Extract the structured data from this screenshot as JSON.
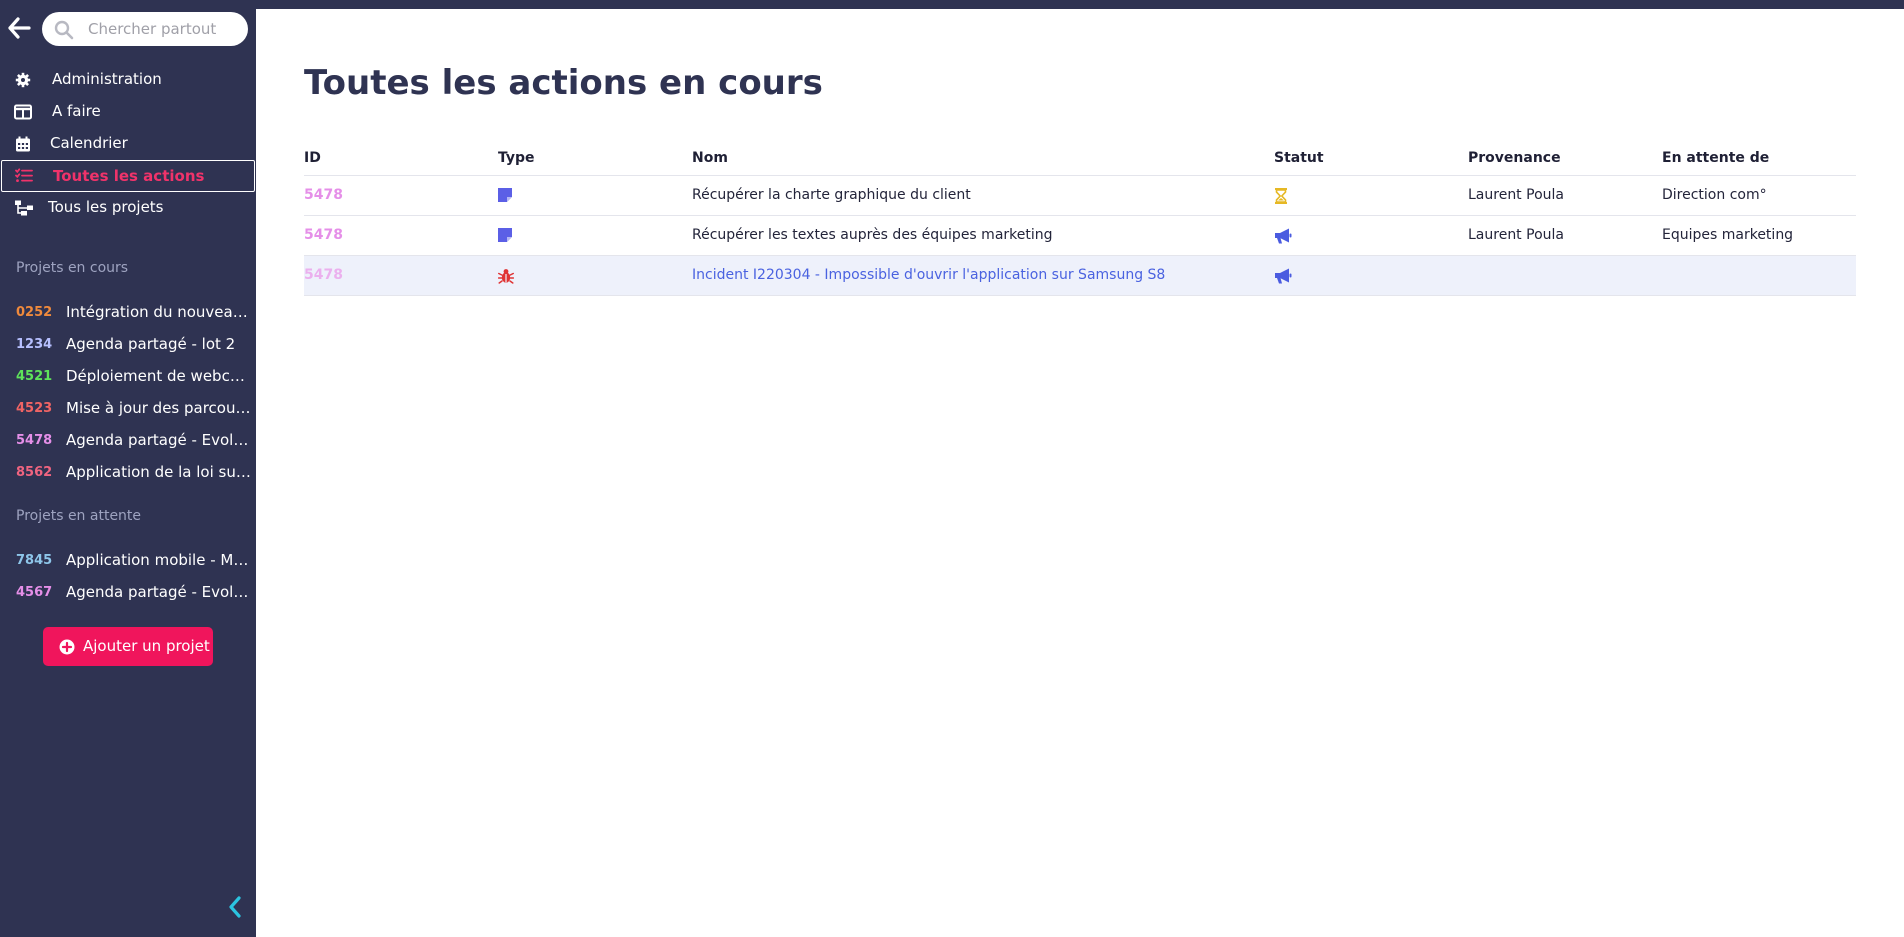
{
  "search": {
    "placeholder": "Chercher partout"
  },
  "nav": [
    {
      "label": "Administration",
      "icon": "gear-icon"
    },
    {
      "label": "A faire",
      "icon": "columns-icon"
    },
    {
      "label": "Calendrier",
      "icon": "calendar-icon"
    },
    {
      "label": "Toutes les actions",
      "icon": "list-check-icon",
      "active": true
    },
    {
      "label": "Tous les projets",
      "icon": "sitemap-icon"
    }
  ],
  "projects_in_progress": {
    "title": "Projets en cours",
    "items": [
      {
        "id": "0252",
        "name": "Intégration du nouveau p...",
        "color": "#f08a3c"
      },
      {
        "id": "1234",
        "name": "Agenda partagé - lot 2",
        "color": "#b7c0ff"
      },
      {
        "id": "4521",
        "name": "Déploiement de webcam ...",
        "color": "#5ee35a"
      },
      {
        "id": "4523",
        "name": "Mise à jour des parcours ...",
        "color": "#f06464"
      },
      {
        "id": "5478",
        "name": "Agenda partagé - Evoluti...",
        "color": "#e58fe8"
      },
      {
        "id": "8562",
        "name": "Application de la loi sur l...",
        "color": "#f06480"
      }
    ]
  },
  "projects_waiting": {
    "title": "Projets en attente",
    "items": [
      {
        "id": "7845",
        "name": "Application mobile - Mise...",
        "color": "#8ec6ea"
      },
      {
        "id": "4567",
        "name": "Agenda partagé - Evoluti...",
        "color": "#e58fe8"
      }
    ]
  },
  "add_project_label": "Ajouter un projet",
  "main": {
    "title": "Toutes les actions en cours",
    "columns": [
      "ID",
      "Type",
      "Nom",
      "Statut",
      "Provenance",
      "En attente de"
    ],
    "rows": [
      {
        "id": "5478",
        "type": "note-icon",
        "name": "Récupérer la charte graphique du client",
        "status": "hourglass-icon",
        "provenance": "Laurent Poula",
        "waiting": "Direction com°"
      },
      {
        "id": "5478",
        "type": "note-icon",
        "name": "Récupérer les textes auprès des équipes marketing",
        "status": "megaphone-icon",
        "provenance": "Laurent Poula",
        "waiting": "Equipes marketing"
      },
      {
        "id": "5478",
        "type": "bug-icon",
        "name": "Incident I220304 - Impossible d'ouvrir l'application sur Samsung S8",
        "status": "megaphone-icon",
        "provenance": "",
        "waiting": ""
      }
    ]
  },
  "colors": {
    "sidebar_bg": "#2f3352",
    "accent": "#f0155c",
    "active_label": "#f0336a",
    "link": "#4a62e0",
    "note_icon": "#5b5fe6",
    "bug_icon": "#e03434",
    "hourglass_icon": "#e6b824"
  }
}
